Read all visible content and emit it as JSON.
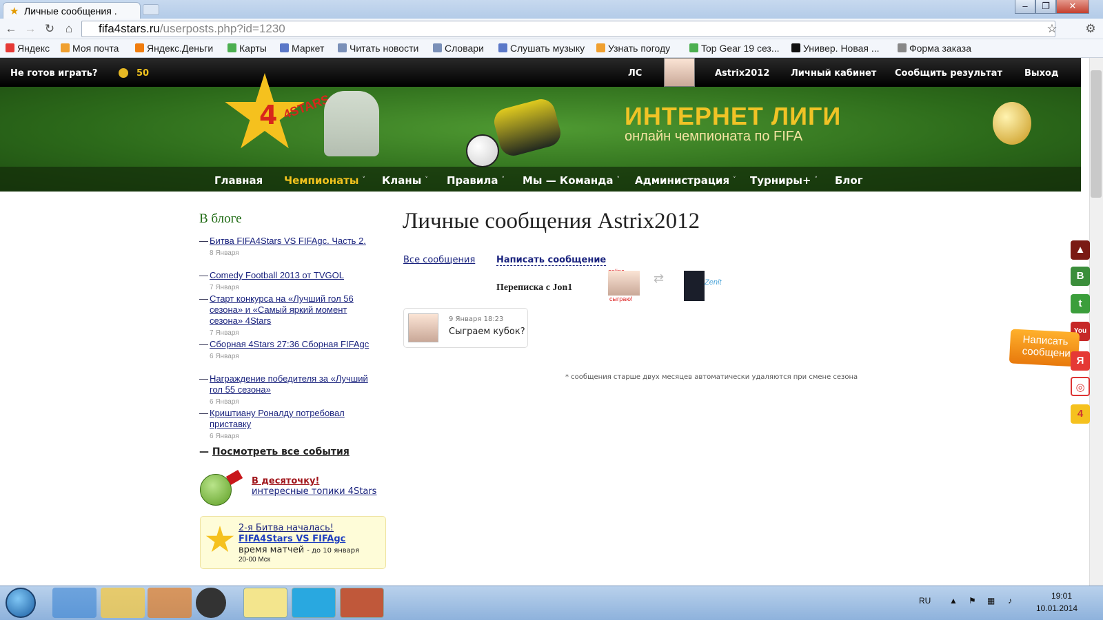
{
  "browser": {
    "tab_title": "Личные сообщения .",
    "url_host": "fifa4stars.ru",
    "url_path": "/userposts.php?id=1230"
  },
  "bookmarks": [
    "Яндекс",
    "Моя почта",
    "Яндекс.Деньги",
    "Карты",
    "Маркет",
    "Читать новости",
    "Словари",
    "Слушать музыку",
    "Узнать погоду",
    "Top Gear 19 сез...",
    "Универ. Новая ...",
    "Форма заказа"
  ],
  "topbar": {
    "not_ready": "Не готов играть?",
    "coins": "50",
    "ls": "ЛС",
    "user": "Astrix2012",
    "cabinet": "Личный кабинет",
    "report": "Сообщить результат",
    "exit": "Выход"
  },
  "banner": {
    "title": "ИНТЕРНЕТ ЛИГИ",
    "subtitle": "онлайн чемпионата по FIFA",
    "logo": "4STARS"
  },
  "menu": [
    "Главная",
    "Чемпионаты",
    "Кланы",
    "Правила",
    "Мы — Команда",
    "Администрация",
    "Турниры+",
    "Блог"
  ],
  "sidebar": {
    "title": "В блоге",
    "items": [
      {
        "t": "Битва FIFA4Stars VS FIFAgc. Часть 2.",
        "d": "8 Января"
      },
      {
        "t": "Comedy Football 2013 от TVGOL",
        "d": "7 Января"
      },
      {
        "t": "Старт конкурса на «Лучший гол 56 сезона» и «Самый яркий момент сезона» 4Stars",
        "d": "7 Января"
      },
      {
        "t": "Сборная 4Stars 27:36 Сборная FIFAgc",
        "d": "6 Января"
      },
      {
        "t": "Награждение победителя за «Лучший гол 55 сезона»",
        "d": "6 Января"
      },
      {
        "t": "Криштиану Роналду потребовал приставку",
        "d": "6 Января"
      }
    ],
    "all": "Посмотреть все события",
    "apple_title": "В десяточку!",
    "apple_sub": "интересные топики 4Stars",
    "promo_1": "2-я Битва началась!",
    "promo_2": "FIFA4Stars VS FIFAgc",
    "promo_3": "время матчей",
    "promo_4": "- до 10 января",
    "promo_5": "20-00 Мск"
  },
  "main": {
    "title": "Личные сообщения Astrix2012",
    "all_msgs": "Все сообщения",
    "write": "Написать сообщение",
    "conv": "Переписка с Jon1",
    "online": "online",
    "play": "сыграю!",
    "msg_date": "9 Января 18:23",
    "msg_text": "Сыграем кубок?",
    "note": "* сообщения старше двух месяцев автоматически удаляются при смене сезона"
  },
  "side_widget": {
    "write": "Написать сообщени"
  },
  "taskbar": {
    "lang": "RU",
    "time": "19:01",
    "date": "10.01.2014"
  }
}
